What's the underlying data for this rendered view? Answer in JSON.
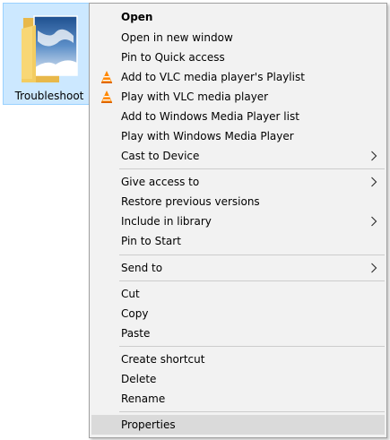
{
  "folder": {
    "label": "Troubleshoot",
    "icon": "folder-image-icon"
  },
  "menu": {
    "items": [
      {
        "label": "Open",
        "bold": true
      },
      {
        "label": "Open in new window"
      },
      {
        "label": "Pin to Quick access"
      },
      {
        "label": "Add to VLC media player's Playlist",
        "icon": "vlc-icon"
      },
      {
        "label": "Play with VLC media player",
        "icon": "vlc-icon"
      },
      {
        "label": "Add to Windows Media Player list"
      },
      {
        "label": "Play with Windows Media Player"
      },
      {
        "label": "Cast to Device",
        "submenu": true
      },
      {
        "label": "Give access to",
        "submenu": true
      },
      {
        "label": "Restore previous versions"
      },
      {
        "label": "Include in library",
        "submenu": true
      },
      {
        "label": "Pin to Start"
      },
      {
        "label": "Send to",
        "submenu": true
      },
      {
        "label": "Cut"
      },
      {
        "label": "Copy"
      },
      {
        "label": "Paste"
      },
      {
        "label": "Create shortcut"
      },
      {
        "label": "Delete"
      },
      {
        "label": "Rename"
      },
      {
        "label": "Properties",
        "highlighted": true
      }
    ]
  },
  "colors": {
    "selection_bg": "#cce8ff",
    "menu_bg": "#f2f2f2",
    "hover_bg": "#dadada",
    "vlc_orange": "#ff8800"
  }
}
